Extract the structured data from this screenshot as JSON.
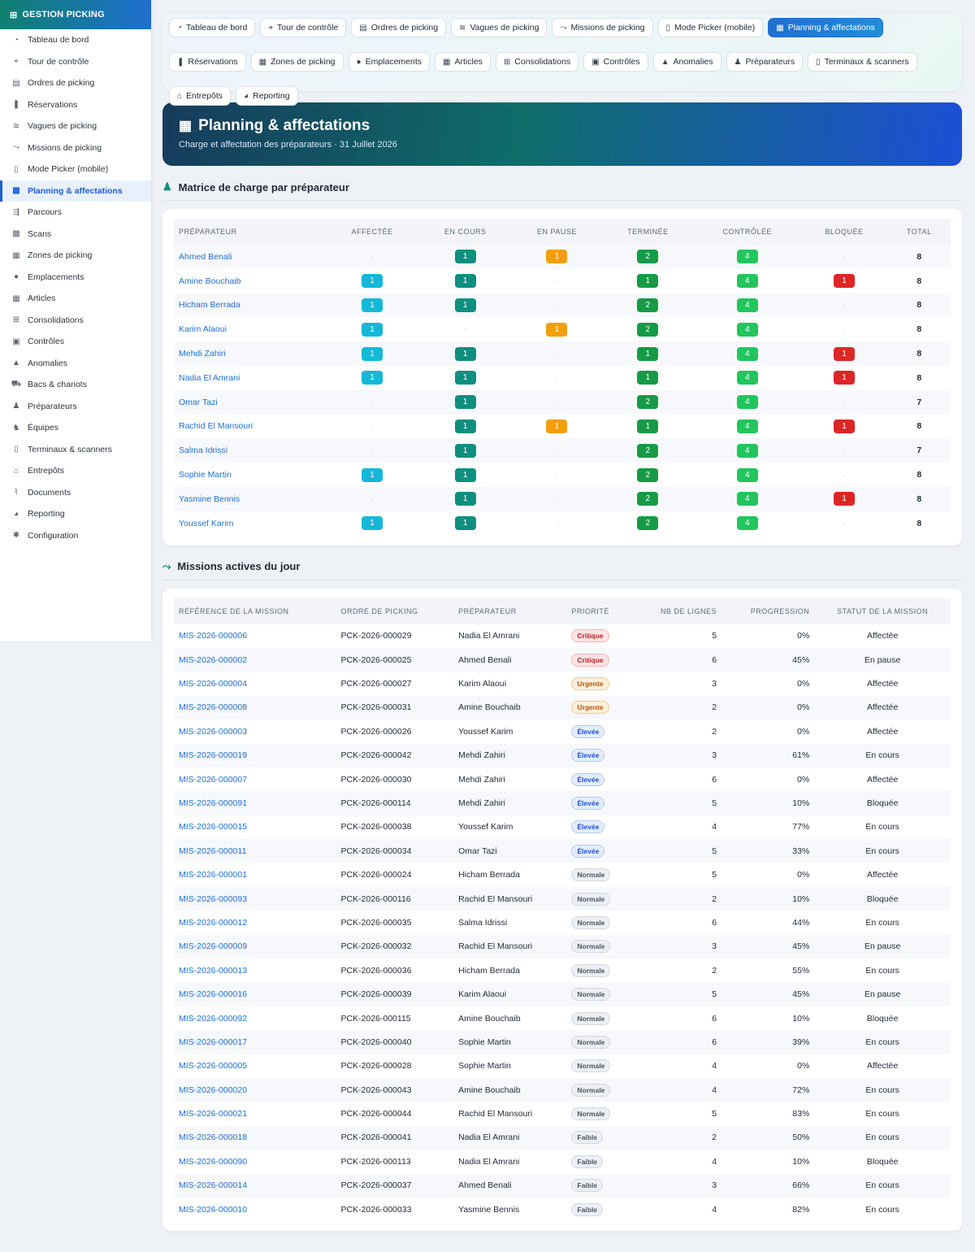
{
  "sidebar": {
    "brand": "GESTION PICKING",
    "items": [
      {
        "label": "Tableau de bord",
        "icon": "gauge-icon",
        "glyph": "◔"
      },
      {
        "label": "Tour de contrôle",
        "icon": "satellite-icon",
        "glyph": "⌖"
      },
      {
        "label": "Ordres de picking",
        "icon": "clipboard-icon",
        "glyph": "▤"
      },
      {
        "label": "Réservations",
        "icon": "bookmark-icon",
        "glyph": "❚"
      },
      {
        "label": "Vagues de picking",
        "icon": "layers-icon",
        "glyph": "≋"
      },
      {
        "label": "Missions de picking",
        "icon": "route-icon",
        "glyph": "⤳"
      },
      {
        "label": "Mode Picker (mobile)",
        "icon": "mobile-icon",
        "glyph": "▯"
      },
      {
        "label": "Planning & affectations",
        "icon": "calendar-icon",
        "glyph": "▦",
        "active": true
      },
      {
        "label": "Parcours",
        "icon": "signs-icon",
        "glyph": "⇶"
      },
      {
        "label": "Scans",
        "icon": "qrcode-icon",
        "glyph": "▩"
      },
      {
        "label": "Zones de picking",
        "icon": "grid-icon",
        "glyph": "▦"
      },
      {
        "label": "Emplacements",
        "icon": "location-pin-icon",
        "glyph": "●"
      },
      {
        "label": "Articles",
        "icon": "boxes-icon",
        "glyph": "▦"
      },
      {
        "label": "Consolidations",
        "icon": "sitemap-icon",
        "glyph": "⊞"
      },
      {
        "label": "Contrôles",
        "icon": "clipboard-check-icon",
        "glyph": "▣"
      },
      {
        "label": "Anomalies",
        "icon": "warning-icon",
        "glyph": "▲"
      },
      {
        "label": "Bacs & chariots",
        "icon": "cart-icon",
        "glyph": "⛟"
      },
      {
        "label": "Préparateurs",
        "icon": "user-gear-icon",
        "glyph": "♟"
      },
      {
        "label": "Équipes",
        "icon": "users-icon",
        "glyph": "♞"
      },
      {
        "label": "Terminaux & scanners",
        "icon": "mobile-icon",
        "glyph": "▯"
      },
      {
        "label": "Entrepôts",
        "icon": "warehouse-icon",
        "glyph": "⌂"
      },
      {
        "label": "Documents",
        "icon": "paperclip-icon",
        "glyph": "⌇"
      },
      {
        "label": "Reporting",
        "icon": "pie-chart-icon",
        "glyph": "◕"
      },
      {
        "label": "Configuration",
        "icon": "gear-icon",
        "glyph": "✱"
      }
    ]
  },
  "tabs": [
    [
      {
        "label": "Tableau de bord",
        "icon": "gauge-icon",
        "glyph": "◔"
      },
      {
        "label": "Tour de contrôle",
        "icon": "satellite-icon",
        "glyph": "⌖"
      },
      {
        "label": "Ordres de picking",
        "icon": "clipboard-icon",
        "glyph": "▤"
      },
      {
        "label": "Vagues de picking",
        "icon": "layers-icon",
        "glyph": "≋"
      },
      {
        "label": "Missions de picking",
        "icon": "route-icon",
        "glyph": "⤳"
      },
      {
        "label": "Mode Picker (mobile)",
        "icon": "mobile-icon",
        "glyph": "▯"
      },
      {
        "label": "Planning & affectations",
        "icon": "calendar-icon",
        "glyph": "▦",
        "active": true
      }
    ],
    [
      {
        "label": "Réservations",
        "icon": "bookmark-icon",
        "glyph": "❚"
      },
      {
        "label": "Zones de picking",
        "icon": "grid-icon",
        "glyph": "▦"
      },
      {
        "label": "Emplacements",
        "icon": "location-pin-icon",
        "glyph": "●"
      },
      {
        "label": "Articles",
        "icon": "boxes-icon",
        "glyph": "▦"
      },
      {
        "label": "Consolidations",
        "icon": "sitemap-icon",
        "glyph": "⊞"
      },
      {
        "label": "Contrôles",
        "icon": "clipboard-check-icon",
        "glyph": "▣"
      },
      {
        "label": "Anomalies",
        "icon": "warning-icon",
        "glyph": "▲"
      },
      {
        "label": "Préparateurs",
        "icon": "user-gear-icon",
        "glyph": "♟"
      },
      {
        "label": "Terminaux & scanners",
        "icon": "mobile-icon",
        "glyph": "▯"
      }
    ],
    [
      {
        "label": "Entrepôts",
        "icon": "warehouse-icon",
        "glyph": "⌂"
      },
      {
        "label": "Reporting",
        "icon": "pie-chart-icon",
        "glyph": "◕"
      }
    ]
  ],
  "hero": {
    "title": "Planning & affectations",
    "subtitle": "Charge et affectation des préparateurs · 31 Juillet 2026"
  },
  "matrix": {
    "title": "Matrice de charge par préparateur",
    "columns": [
      "PRÉPARATEUR",
      "AFFECTÉE",
      "EN COURS",
      "EN PAUSE",
      "TERMINÉE",
      "CONTRÔLÉE",
      "BLOQUÉE",
      "TOTAL"
    ],
    "empty_symbol": "·",
    "rows": [
      {
        "name": "Ahmed Benali",
        "affectee": null,
        "encours": "1",
        "pause": "1",
        "terminee": "2",
        "controlee": "4",
        "bloquee": null,
        "total": "8"
      },
      {
        "name": "Amine Bouchaib",
        "affectee": "1",
        "encours": "1",
        "pause": null,
        "terminee": "1",
        "controlee": "4",
        "bloquee": "1",
        "total": "8"
      },
      {
        "name": "Hicham Berrada",
        "affectee": "1",
        "encours": "1",
        "pause": null,
        "terminee": "2",
        "controlee": "4",
        "bloquee": null,
        "total": "8"
      },
      {
        "name": "Karim Alaoui",
        "affectee": "1",
        "encours": null,
        "pause": "1",
        "terminee": "2",
        "controlee": "4",
        "bloquee": null,
        "total": "8"
      },
      {
        "name": "Mehdi Zahiri",
        "affectee": "1",
        "encours": "1",
        "pause": null,
        "terminee": "1",
        "controlee": "4",
        "bloquee": "1",
        "total": "8"
      },
      {
        "name": "Nadia El Amrani",
        "affectee": "1",
        "encours": "1",
        "pause": null,
        "terminee": "1",
        "controlee": "4",
        "bloquee": "1",
        "total": "8"
      },
      {
        "name": "Omar Tazi",
        "affectee": null,
        "encours": "1",
        "pause": null,
        "terminee": "2",
        "controlee": "4",
        "bloquee": null,
        "total": "7"
      },
      {
        "name": "Rachid El Mansouri",
        "affectee": null,
        "encours": "1",
        "pause": "1",
        "terminee": "1",
        "controlee": "4",
        "bloquee": "1",
        "total": "8"
      },
      {
        "name": "Salma Idrissi",
        "affectee": null,
        "encours": "1",
        "pause": null,
        "terminee": "2",
        "controlee": "4",
        "bloquee": null,
        "total": "7"
      },
      {
        "name": "Sophie Martin",
        "affectee": "1",
        "encours": "1",
        "pause": null,
        "terminee": "2",
        "controlee": "4",
        "bloquee": null,
        "total": "8"
      },
      {
        "name": "Yasmine Bennis",
        "affectee": null,
        "encours": "1",
        "pause": null,
        "terminee": "2",
        "controlee": "4",
        "bloquee": "1",
        "total": "8"
      },
      {
        "name": "Youssef Karim",
        "affectee": "1",
        "encours": "1",
        "pause": null,
        "terminee": "2",
        "controlee": "4",
        "bloquee": null,
        "total": "8"
      }
    ]
  },
  "missions": {
    "title": "Missions actives du jour",
    "columns": [
      "RÉFÉRENCE DE LA MISSION",
      "ORDRE DE PICKING",
      "PRÉPARATEUR",
      "PRIORITÉ",
      "NB DE LIGNES",
      "PROGRESSION",
      "STATUT DE LA MISSION"
    ],
    "rows": [
      {
        "ref": "MIS-2026-000006",
        "order": "PCK-2026-000029",
        "picker": "Nadia El Amrani",
        "priority": "Critique",
        "lines": "5",
        "progress": "0%",
        "status": "Affectée"
      },
      {
        "ref": "MIS-2026-000002",
        "order": "PCK-2026-000025",
        "picker": "Ahmed Benali",
        "priority": "Critique",
        "lines": "6",
        "progress": "45%",
        "status": "En pause"
      },
      {
        "ref": "MIS-2026-000004",
        "order": "PCK-2026-000027",
        "picker": "Karim Alaoui",
        "priority": "Urgente",
        "lines": "3",
        "progress": "0%",
        "status": "Affectée"
      },
      {
        "ref": "MIS-2026-000008",
        "order": "PCK-2026-000031",
        "picker": "Amine Bouchaib",
        "priority": "Urgente",
        "lines": "2",
        "progress": "0%",
        "status": "Affectée"
      },
      {
        "ref": "MIS-2026-000003",
        "order": "PCK-2026-000026",
        "picker": "Youssef Karim",
        "priority": "Élevée",
        "lines": "2",
        "progress": "0%",
        "status": "Affectée"
      },
      {
        "ref": "MIS-2026-000019",
        "order": "PCK-2026-000042",
        "picker": "Mehdi Zahiri",
        "priority": "Élevée",
        "lines": "3",
        "progress": "61%",
        "status": "En cours"
      },
      {
        "ref": "MIS-2026-000007",
        "order": "PCK-2026-000030",
        "picker": "Mehdi Zahiri",
        "priority": "Élevée",
        "lines": "6",
        "progress": "0%",
        "status": "Affectée"
      },
      {
        "ref": "MIS-2026-000091",
        "order": "PCK-2026-000114",
        "picker": "Mehdi Zahiri",
        "priority": "Élevée",
        "lines": "5",
        "progress": "10%",
        "status": "Bloquée"
      },
      {
        "ref": "MIS-2026-000015",
        "order": "PCK-2026-000038",
        "picker": "Youssef Karim",
        "priority": "Élevée",
        "lines": "4",
        "progress": "77%",
        "status": "En cours"
      },
      {
        "ref": "MIS-2026-000011",
        "order": "PCK-2026-000034",
        "picker": "Omar Tazi",
        "priority": "Élevée",
        "lines": "5",
        "progress": "33%",
        "status": "En cours"
      },
      {
        "ref": "MIS-2026-000001",
        "order": "PCK-2026-000024",
        "picker": "Hicham Berrada",
        "priority": "Normale",
        "lines": "5",
        "progress": "0%",
        "status": "Affectée"
      },
      {
        "ref": "MIS-2026-000093",
        "order": "PCK-2026-000116",
        "picker": "Rachid El Mansouri",
        "priority": "Normale",
        "lines": "2",
        "progress": "10%",
        "status": "Bloquée"
      },
      {
        "ref": "MIS-2026-000012",
        "order": "PCK-2026-000035",
        "picker": "Salma Idrissi",
        "priority": "Normale",
        "lines": "6",
        "progress": "44%",
        "status": "En cours"
      },
      {
        "ref": "MIS-2026-000009",
        "order": "PCK-2026-000032",
        "picker": "Rachid El Mansouri",
        "priority": "Normale",
        "lines": "3",
        "progress": "45%",
        "status": "En pause"
      },
      {
        "ref": "MIS-2026-000013",
        "order": "PCK-2026-000036",
        "picker": "Hicham Berrada",
        "priority": "Normale",
        "lines": "2",
        "progress": "55%",
        "status": "En cours"
      },
      {
        "ref": "MIS-2026-000016",
        "order": "PCK-2026-000039",
        "picker": "Karim Alaoui",
        "priority": "Normale",
        "lines": "5",
        "progress": "45%",
        "status": "En pause"
      },
      {
        "ref": "MIS-2026-000092",
        "order": "PCK-2026-000115",
        "picker": "Amine Bouchaib",
        "priority": "Normale",
        "lines": "6",
        "progress": "10%",
        "status": "Bloquée"
      },
      {
        "ref": "MIS-2026-000017",
        "order": "PCK-2026-000040",
        "picker": "Sophie Martin",
        "priority": "Normale",
        "lines": "6",
        "progress": "39%",
        "status": "En cours"
      },
      {
        "ref": "MIS-2026-000005",
        "order": "PCK-2026-000028",
        "picker": "Sophie Martin",
        "priority": "Normale",
        "lines": "4",
        "progress": "0%",
        "status": "Affectée"
      },
      {
        "ref": "MIS-2026-000020",
        "order": "PCK-2026-000043",
        "picker": "Amine Bouchaib",
        "priority": "Normale",
        "lines": "4",
        "progress": "72%",
        "status": "En cours"
      },
      {
        "ref": "MIS-2026-000021",
        "order": "PCK-2026-000044",
        "picker": "Rachid El Mansouri",
        "priority": "Normale",
        "lines": "5",
        "progress": "83%",
        "status": "En cours"
      },
      {
        "ref": "MIS-2026-000018",
        "order": "PCK-2026-000041",
        "picker": "Nadia El Amrani",
        "priority": "Faible",
        "lines": "2",
        "progress": "50%",
        "status": "En cours"
      },
      {
        "ref": "MIS-2026-000090",
        "order": "PCK-2026-000113",
        "picker": "Nadia El Amrani",
        "priority": "Faible",
        "lines": "4",
        "progress": "10%",
        "status": "Bloquée"
      },
      {
        "ref": "MIS-2026-000014",
        "order": "PCK-2026-000037",
        "picker": "Ahmed Benali",
        "priority": "Faible",
        "lines": "3",
        "progress": "66%",
        "status": "En cours"
      },
      {
        "ref": "MIS-2026-000010",
        "order": "PCK-2026-000033",
        "picker": "Yasmine Bennis",
        "priority": "Faible",
        "lines": "4",
        "progress": "82%",
        "status": "En cours"
      }
    ]
  },
  "colors": {
    "accent": "#1f6fd1",
    "teal": "#0f8f7f",
    "affectee": "#14b8d9",
    "pause": "#f59e0b",
    "terminee": "#169a47",
    "controlee": "#22c55e",
    "bloquee": "#dc2626"
  }
}
